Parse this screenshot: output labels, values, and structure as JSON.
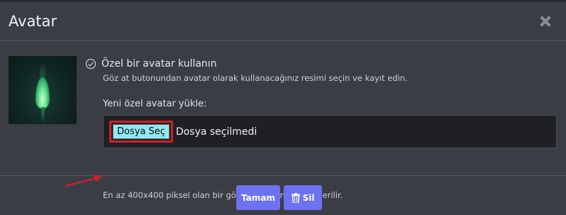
{
  "dialog": {
    "title": "Avatar",
    "close_icon": "close-icon"
  },
  "option": {
    "label": "Özel bir avatar kullanın",
    "icon": "check-circle-icon",
    "hint": "Göz at butonundan avatar olarak kullanacağınız resimi seçin ve kayıt edin."
  },
  "upload": {
    "label": "Yeni özel avatar yükle:",
    "button_label": "Dosya Seç",
    "status": "Dosya seçilmedi",
    "hint": "En az 400x400 piksel olan bir görüntü kullanmanız önerilir."
  },
  "footer": {
    "ok_label": "Tamam",
    "delete_label": "Sil",
    "delete_icon": "trash-icon"
  },
  "colors": {
    "accent": "#6c72f0",
    "highlight": "#d11f2a",
    "file_button": "#8fe9f0"
  }
}
